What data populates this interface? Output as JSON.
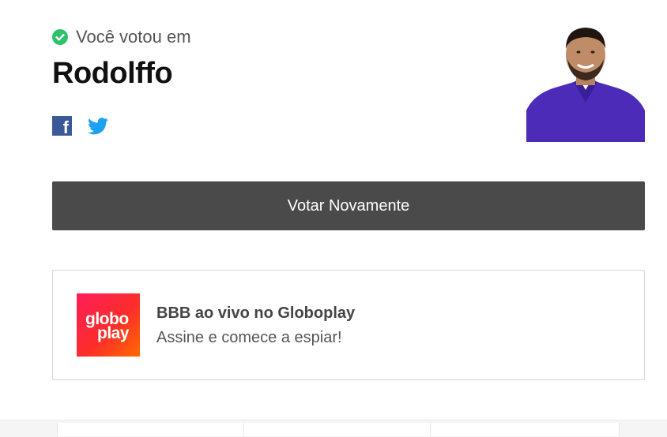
{
  "vote": {
    "confirmation_label": "Você votou em",
    "candidate_name": "Rodolffo"
  },
  "share": {
    "facebook_icon": "facebook-icon",
    "twitter_icon": "twitter-icon"
  },
  "actions": {
    "vote_again_label": "Votar Novamente"
  },
  "promo": {
    "logo_line1": "globo",
    "logo_line2": "play",
    "title": "BBB ao vivo no Globoplay",
    "subtitle": "Assine e comece a espiar!"
  },
  "colors": {
    "check": "#2dc26b",
    "button_bg": "#4a4a4a",
    "facebook": "#3b5998",
    "twitter": "#1da1f2"
  }
}
